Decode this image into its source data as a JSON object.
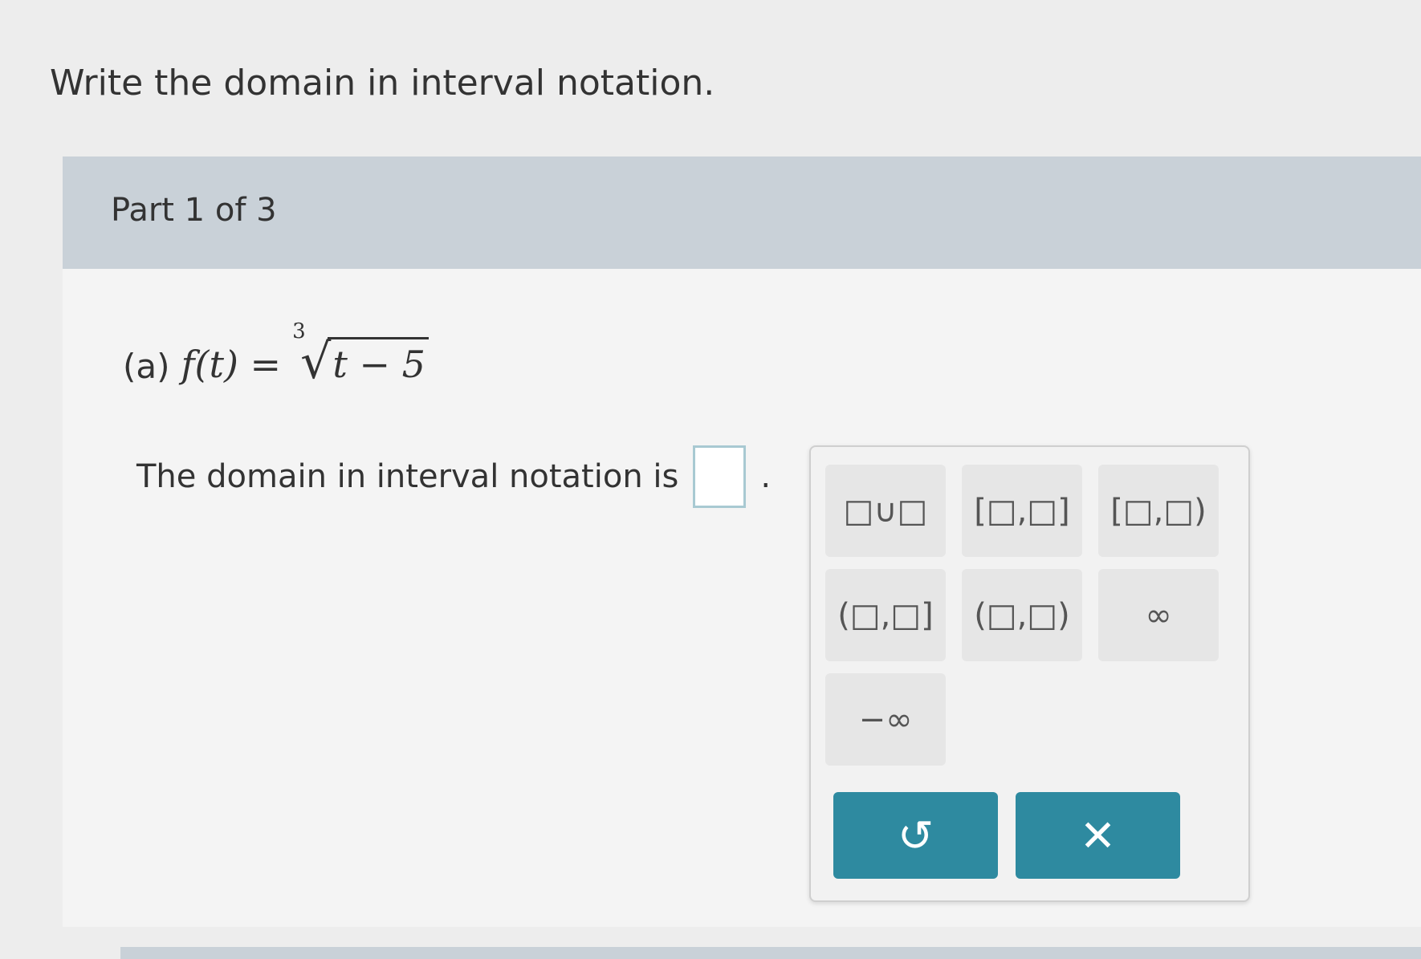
{
  "prompt": "Write the domain in interval notation.",
  "part": {
    "label": "Part 1 of 3"
  },
  "problem": {
    "prefix": "(a)",
    "function_lhs": "f(t) =",
    "root_index": "3",
    "radicand": "t − 5"
  },
  "answer": {
    "label": "The domain in interval notation is",
    "trailing": "."
  },
  "palette": {
    "keys": [
      {
        "name": "union",
        "label": "□∪□"
      },
      {
        "name": "closed-closed",
        "label": "[□,□]"
      },
      {
        "name": "closed-open",
        "label": "[□,□)"
      },
      {
        "name": "open-closed",
        "label": "(□,□]"
      },
      {
        "name": "open-open",
        "label": "(□,□)"
      },
      {
        "name": "infinity",
        "label": "∞"
      },
      {
        "name": "negative-infinity",
        "label": "−∞"
      }
    ],
    "undo_icon": "↺",
    "clear_icon": "✕"
  }
}
